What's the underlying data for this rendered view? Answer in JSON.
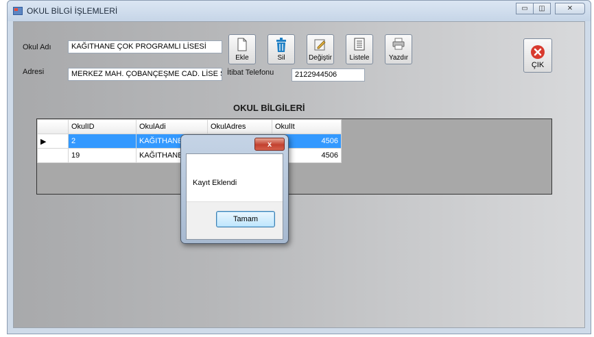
{
  "window": {
    "title": "OKUL BİLGİ İŞLEMLERİ",
    "min_glyph": "▭",
    "max_glyph": "◫",
    "close_glyph": "✕"
  },
  "form": {
    "okul_adi_label": "Okul Adı",
    "okul_adi_value": "KAĞITHANE ÇOK PROGRAMLI LİSESİ",
    "adresi_label": "Adresi",
    "adresi_value": "MERKEZ MAH. ÇOBANÇEŞME CAD. LİSE S(",
    "iletisim_label": "İtibat Telefonu",
    "telefon_value": "2122944506"
  },
  "toolbar": {
    "ekle": "Ekle",
    "sil": "Sil",
    "degistir": "Değiştir",
    "listele": "Listele",
    "yazdir": "Yazdır",
    "cik": "ÇIK"
  },
  "section_title": "OKUL BİLGİLERİ",
  "grid": {
    "columns": [
      "OkulID",
      "OkulAdi",
      "OkulAdres",
      "OkulIt"
    ],
    "rows": [
      {
        "id": "2",
        "adi": "KAĞITHANE ÇO",
        "adres": "",
        "tel": "4506"
      },
      {
        "id": "19",
        "adi": "KAĞITHANE ÇO",
        "adres": "",
        "tel": "4506"
      }
    ]
  },
  "dialog": {
    "close_glyph": "x",
    "message": "Kayıt Eklendi",
    "ok": "Tamam"
  },
  "colors": {
    "selection": "#3399ff",
    "exit_icon": "#d83a2e"
  }
}
